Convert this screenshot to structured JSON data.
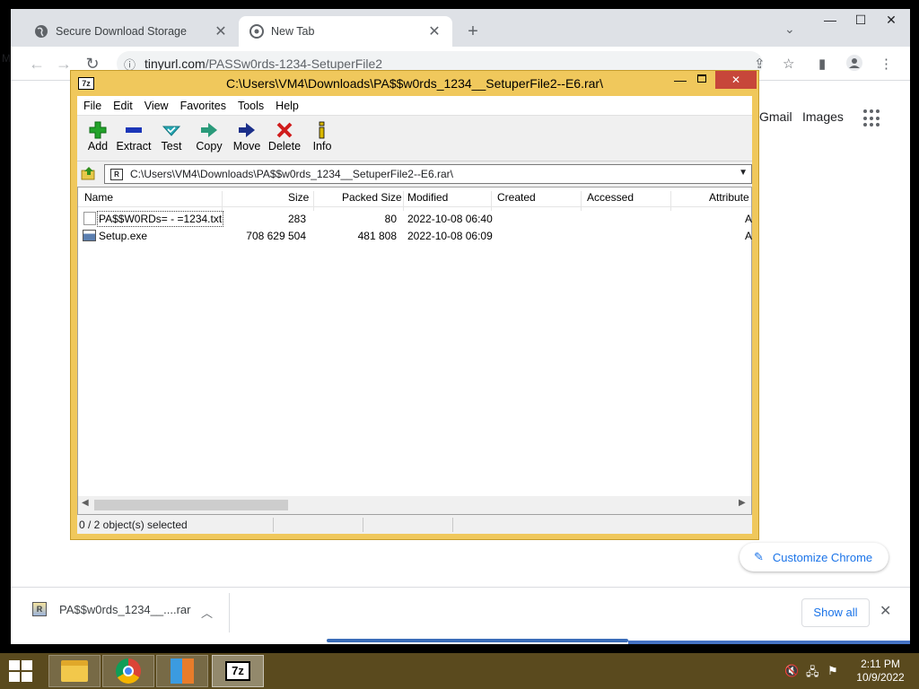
{
  "browser": {
    "tabs": [
      {
        "label": "Secure Download Storage",
        "close": "✕"
      },
      {
        "label": "New Tab",
        "close": "✕"
      }
    ],
    "new_tab": "+",
    "window_controls": {
      "minimize": "—",
      "maximize": "☐",
      "close": "✕"
    },
    "nav": {
      "back": "←",
      "forward": "→",
      "reload": "↻"
    },
    "url_host": "tinyurl.com",
    "url_path": "/PASSw0rds-1234-SetuperFile2",
    "edge_char": "M",
    "ntp": {
      "gmail": "Gmail",
      "images": "Images",
      "customize": "Customize Chrome"
    },
    "download": {
      "filename": "PA$$w0rds_1234__....rar",
      "show_all": "Show all",
      "close": "✕"
    }
  },
  "sevenzip": {
    "title": "C:\\Users\\VM4\\Downloads\\PA$$w0rds_1234__SetuperFile2--E6.rar\\",
    "close": "✕",
    "menu": [
      "File",
      "Edit",
      "View",
      "Favorites",
      "Tools",
      "Help"
    ],
    "tools": [
      {
        "label": "Add",
        "icon": "plus-icon",
        "color": "#22a32a"
      },
      {
        "label": "Extract",
        "icon": "minus-icon",
        "color": "#1b36b8"
      },
      {
        "label": "Test",
        "icon": "check-icon",
        "color": "#27a8b5"
      },
      {
        "label": "Copy",
        "icon": "copy-arrow-icon",
        "color": "#2a9a7a"
      },
      {
        "label": "Move",
        "icon": "move-arrow-icon",
        "color": "#1b2f8a"
      },
      {
        "label": "Delete",
        "icon": "x-icon",
        "color": "#d01c1c"
      },
      {
        "label": "Info",
        "icon": "info-icon",
        "color": "#d9b800"
      }
    ],
    "address": "C:\\Users\\VM4\\Downloads\\PA$$w0rds_1234__SetuperFile2--E6.rar\\",
    "columns": [
      "Name",
      "Size",
      "Packed Size",
      "Modified",
      "Created",
      "Accessed",
      "Attribute"
    ],
    "files": [
      {
        "name": "PA$$W0RDs= - =1234.txt",
        "size": "283",
        "packed": "80",
        "modified": "2022-10-08 06:40",
        "attr": "A"
      },
      {
        "name": "Setup.exe",
        "size": "708 629 504",
        "packed": "481 808",
        "modified": "2022-10-08 06:09",
        "attr": "A"
      }
    ],
    "status": "0 / 2 object(s) selected"
  },
  "taskbar": {
    "seven_z_label": "7z",
    "time": "2:11 PM",
    "date": "10/9/2022"
  }
}
